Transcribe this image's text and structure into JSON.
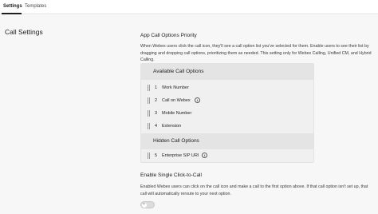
{
  "tabs": [
    {
      "label": "Settings",
      "active": true
    },
    {
      "label": "Templates",
      "active": false
    }
  ],
  "section_title": "Call Settings",
  "priority": {
    "heading": "App Call Options Priority",
    "description": "When Webex users click the call icon, they'll see a call option list you've selected for them. Enable users to see their list by dragging and dropping call options, prioritizing them as needed. This setting only for Webex Calling, Unified CM, and Hybrid Calling.",
    "available_header": "Available Call Options",
    "hidden_header": "Hidden Call Options",
    "available_options": [
      {
        "num": "1",
        "label": "Work Number",
        "info": false
      },
      {
        "num": "2",
        "label": "Call on Webex",
        "info": true
      },
      {
        "num": "3",
        "label": "Mobile Number",
        "info": false
      },
      {
        "num": "4",
        "label": "Extension",
        "info": false
      }
    ],
    "hidden_options": [
      {
        "num": "5",
        "label": "Enterprise SIP URI",
        "info": true
      }
    ]
  },
  "single_click": {
    "title": "Enable Single Click-to-Call",
    "description": "Enabled Webex users can click on the call icon and make a call to the first option above. If that call option isn't set up, that call will automatically reroute to your next option.",
    "toggle_on": false,
    "toggle_symbol": "×"
  },
  "icons": {
    "info": "info-icon",
    "drag": "drag-handle-icon"
  },
  "colors": {
    "background": "#f7f7f7",
    "box": "#f0f0f0",
    "box_header": "#e4e4e4"
  }
}
